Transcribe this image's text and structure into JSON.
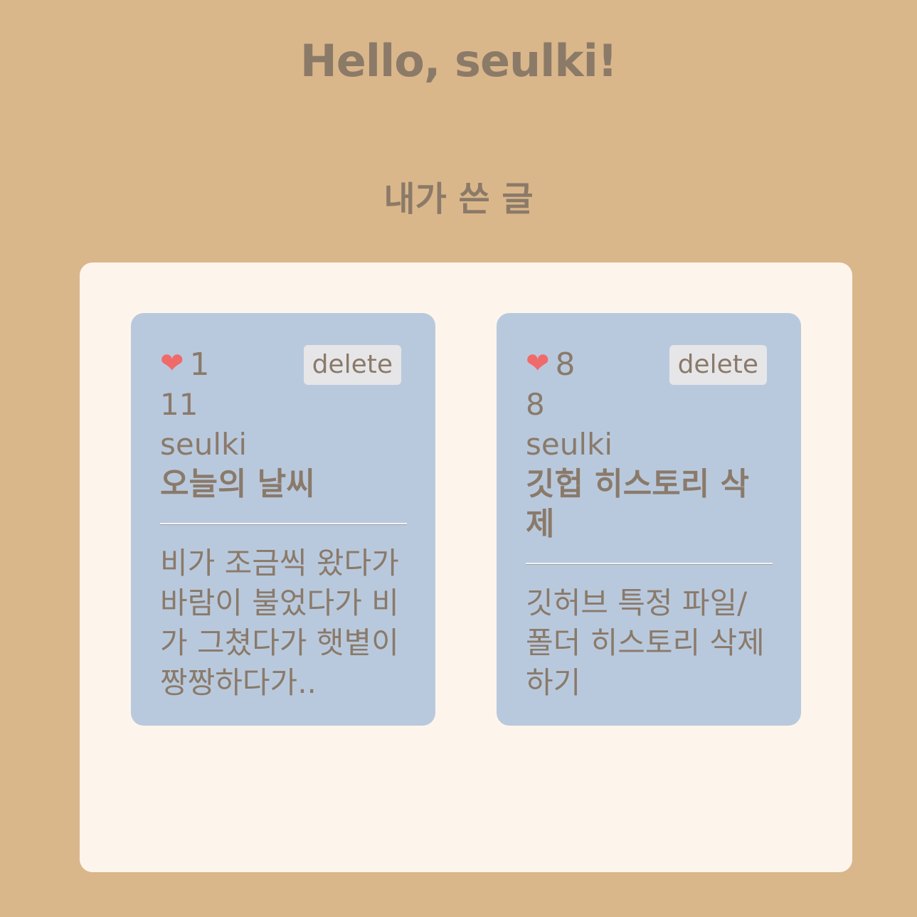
{
  "header": {
    "greeting": "Hello, seulki!"
  },
  "section": {
    "title": "내가 쓴 글"
  },
  "colors": {
    "page_bg": "#d9b78b",
    "panel_bg": "#fdf5ec",
    "card_bg": "#b9c9dd",
    "text": "#8a7a6a",
    "heart": "#f06a6a",
    "button_bg": "#e6e6e8"
  },
  "posts": [
    {
      "likes": "1",
      "id": "11",
      "author": "seulki",
      "title": "오늘의 날씨",
      "body": "비가 조금씩 왔다가 바람이 불었다가 비가 그쳤다가 햇볕이 짱짱하다가..",
      "delete_label": "delete",
      "heart_icon": "heart-icon"
    },
    {
      "likes": "8",
      "id": "8",
      "author": "seulki",
      "title": "깃헙 히스토리 삭제",
      "body": "깃허브 특정 파일/폴더 히스토리 삭제하기",
      "delete_label": "delete",
      "heart_icon": "heart-icon"
    }
  ]
}
